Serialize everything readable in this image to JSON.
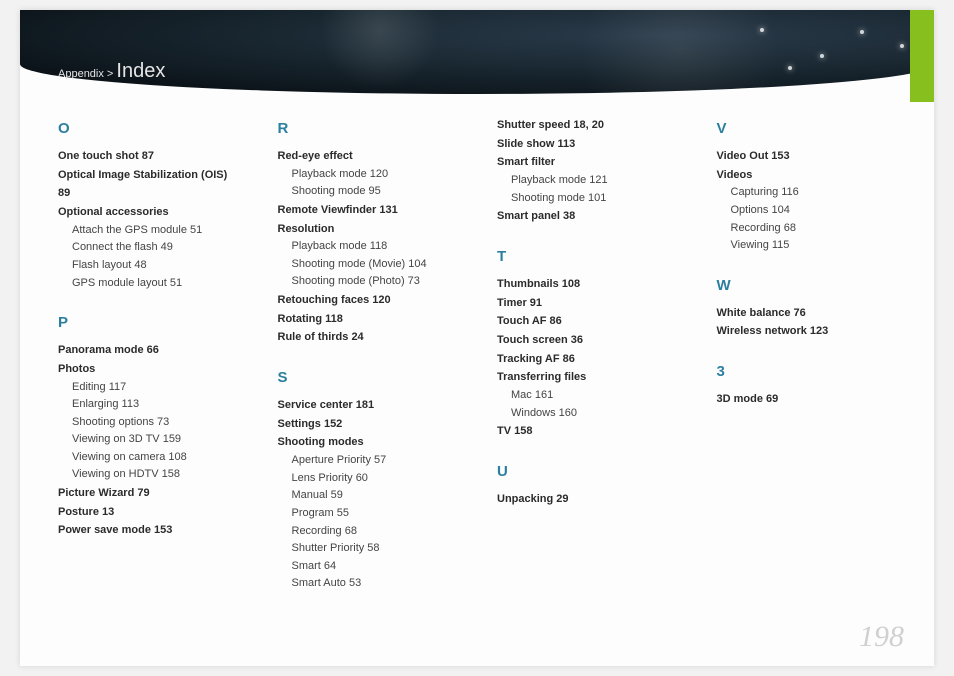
{
  "breadcrumb": {
    "prefix": "Appendix >",
    "title": "Index"
  },
  "page_number": "198",
  "columns": [
    {
      "sections": [
        {
          "letter": "O",
          "items": [
            {
              "type": "entry",
              "text": "One touch shot  87"
            },
            {
              "type": "entry",
              "text": "Optical Image Stabilization (OIS)  89"
            },
            {
              "type": "entry",
              "text": "Optional accessories"
            },
            {
              "type": "sub",
              "text": "Attach the GPS module  51"
            },
            {
              "type": "sub",
              "text": "Connect the flash  49"
            },
            {
              "type": "sub",
              "text": "Flash layout  48"
            },
            {
              "type": "sub",
              "text": "GPS module layout  51"
            }
          ]
        },
        {
          "letter": "P",
          "items": [
            {
              "type": "entry",
              "text": "Panorama mode  66"
            },
            {
              "type": "entry",
              "text": "Photos"
            },
            {
              "type": "sub",
              "text": "Editing  117"
            },
            {
              "type": "sub",
              "text": "Enlarging  113"
            },
            {
              "type": "sub",
              "text": "Shooting options  73"
            },
            {
              "type": "sub",
              "text": "Viewing on 3D TV  159"
            },
            {
              "type": "sub",
              "text": "Viewing on camera  108"
            },
            {
              "type": "sub",
              "text": "Viewing on HDTV  158"
            },
            {
              "type": "entry",
              "text": "Picture Wizard  79"
            },
            {
              "type": "entry",
              "text": "Posture  13"
            },
            {
              "type": "entry",
              "text": "Power save mode  153"
            }
          ]
        }
      ]
    },
    {
      "sections": [
        {
          "letter": "R",
          "items": [
            {
              "type": "entry",
              "text": "Red-eye effect"
            },
            {
              "type": "sub",
              "text": "Playback mode  120"
            },
            {
              "type": "sub",
              "text": "Shooting mode  95"
            },
            {
              "type": "entry",
              "text": "Remote Viewfinder  131"
            },
            {
              "type": "entry",
              "text": "Resolution"
            },
            {
              "type": "sub",
              "text": "Playback mode  118"
            },
            {
              "type": "sub",
              "text": "Shooting mode (Movie)  104"
            },
            {
              "type": "sub",
              "text": "Shooting mode (Photo)  73"
            },
            {
              "type": "entry",
              "text": "Retouching faces  120"
            },
            {
              "type": "entry",
              "text": "Rotating  118"
            },
            {
              "type": "entry",
              "text": "Rule of thirds  24"
            }
          ]
        },
        {
          "letter": "S",
          "items": [
            {
              "type": "entry",
              "text": "Service center  181"
            },
            {
              "type": "entry",
              "text": "Settings  152"
            },
            {
              "type": "entry",
              "text": "Shooting modes"
            },
            {
              "type": "sub",
              "text": "Aperture Priority  57"
            },
            {
              "type": "sub",
              "text": "Lens Priority  60"
            },
            {
              "type": "sub",
              "text": "Manual  59"
            },
            {
              "type": "sub",
              "text": "Program  55"
            },
            {
              "type": "sub",
              "text": "Recording  68"
            },
            {
              "type": "sub",
              "text": "Shutter Priority  58"
            },
            {
              "type": "sub",
              "text": "Smart  64"
            },
            {
              "type": "sub",
              "text": "Smart Auto  53"
            }
          ]
        }
      ]
    },
    {
      "sections": [
        {
          "letter": "",
          "items": [
            {
              "type": "entry",
              "text": "Shutter speed  18, 20"
            },
            {
              "type": "entry",
              "text": "Slide show  113"
            },
            {
              "type": "entry",
              "text": "Smart filter"
            },
            {
              "type": "sub",
              "text": "Playback mode  121"
            },
            {
              "type": "sub",
              "text": "Shooting mode  101"
            },
            {
              "type": "entry",
              "text": "Smart panel  38"
            }
          ]
        },
        {
          "letter": "T",
          "items": [
            {
              "type": "entry",
              "text": "Thumbnails  108"
            },
            {
              "type": "entry",
              "text": "Timer  91"
            },
            {
              "type": "entry",
              "text": "Touch AF  86"
            },
            {
              "type": "entry",
              "text": "Touch screen  36"
            },
            {
              "type": "entry",
              "text": "Tracking AF  86"
            },
            {
              "type": "entry",
              "text": "Transferring files"
            },
            {
              "type": "sub",
              "text": "Mac  161"
            },
            {
              "type": "sub",
              "text": "Windows  160"
            },
            {
              "type": "entry",
              "text": "TV  158"
            }
          ]
        },
        {
          "letter": "U",
          "items": [
            {
              "type": "entry",
              "text": "Unpacking  29"
            }
          ]
        }
      ]
    },
    {
      "sections": [
        {
          "letter": "V",
          "items": [
            {
              "type": "entry",
              "text": "Video Out  153"
            },
            {
              "type": "entry",
              "text": "Videos"
            },
            {
              "type": "sub",
              "text": "Capturing  116"
            },
            {
              "type": "sub",
              "text": "Options  104"
            },
            {
              "type": "sub",
              "text": "Recording  68"
            },
            {
              "type": "sub",
              "text": "Viewing  115"
            }
          ]
        },
        {
          "letter": "W",
          "items": [
            {
              "type": "entry",
              "text": "White balance  76"
            },
            {
              "type": "entry",
              "text": "Wireless network  123"
            }
          ]
        },
        {
          "letter": "3",
          "items": [
            {
              "type": "entry",
              "text": "3D mode  69"
            }
          ]
        }
      ]
    }
  ]
}
